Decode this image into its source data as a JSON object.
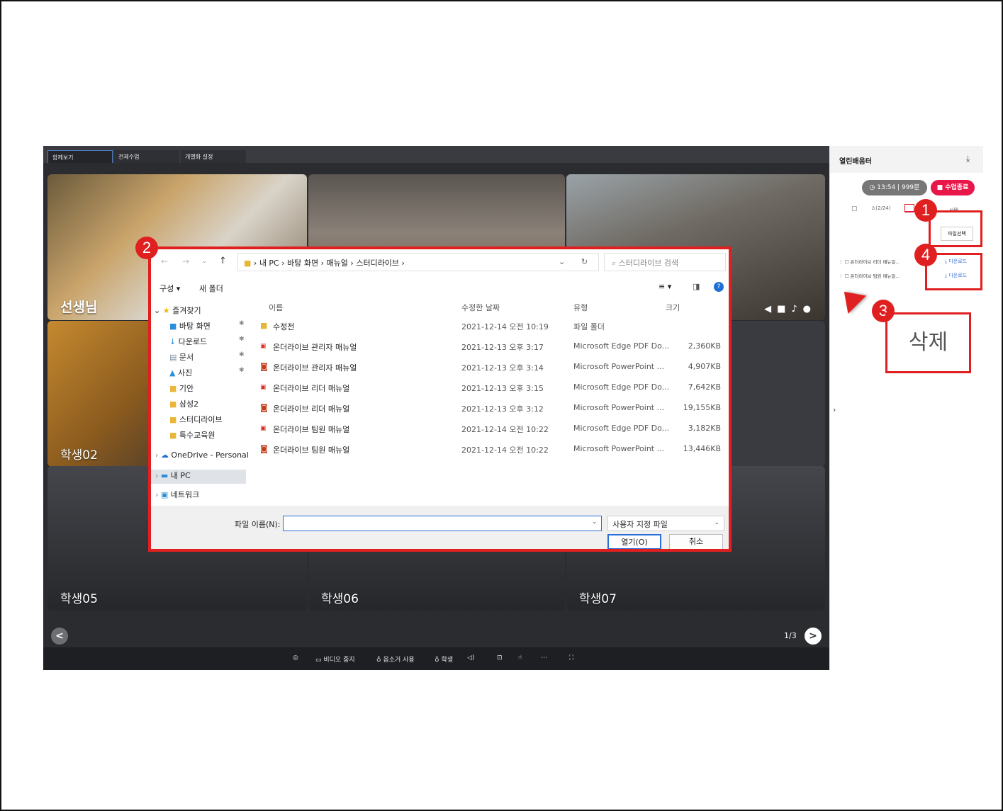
{
  "app": {
    "tabs": [
      "함께보기",
      "전체수업",
      "개별화 설정"
    ],
    "tiles": [
      {
        "label": "선생님"
      },
      {
        "label": "학생02"
      },
      {
        "label": "학생05"
      },
      {
        "label": "학생06"
      },
      {
        "label": "학생07"
      }
    ],
    "pager": {
      "prev": "<",
      "next": ">",
      "indicator": "1/3"
    },
    "bottom_bar": {
      "video_stop": "비디오 중지",
      "mic_use": "음소거 사용",
      "student": "학생"
    },
    "colors": {
      "accent": "#e02020",
      "link": "#3a6fd8",
      "bg": "#2b2c30"
    }
  },
  "side_panel": {
    "title": "열린배움터",
    "timer": "13:54",
    "duration": "999분",
    "end_class": "수업종료",
    "tab_count": "(2/24)",
    "tab_more": "선택",
    "choose_file": "파일선택",
    "files": [
      {
        "name": "온더라이브 리더 매뉴얼...",
        "action": "다운로드"
      },
      {
        "name": "온더라이브 팀원 매뉴얼...",
        "action": "다운로드"
      }
    ],
    "collapse": "›"
  },
  "dialog": {
    "breadcrumb": [
      "내 PC",
      "바탕 화면",
      "매뉴얼",
      "스터디라이브"
    ],
    "search_placeholder": "스터디라이브 검색",
    "organize": "구성 ▾",
    "new_folder": "새 폴더",
    "nav": {
      "favorites": "즐겨찾기",
      "items": [
        "바탕 화면",
        "다운로드",
        "문서",
        "사진",
        "기안",
        "삼성2",
        "스터디라이브",
        "특수교육원"
      ],
      "onedrive": "OneDrive - Personal",
      "my_pc": "내 PC",
      "network": "네트워크"
    },
    "columns": [
      "이름",
      "수정한 날짜",
      "유형",
      "크기"
    ],
    "rows": [
      {
        "name": "수정전",
        "date": "2021-12-14 오전 10:19",
        "type": "파일 폴더",
        "size": "",
        "icon": "folder"
      },
      {
        "name": "온더라이브 관리자 매뉴얼",
        "date": "2021-12-13 오후 3:17",
        "type": "Microsoft Edge PDF Do...",
        "size": "2,360KB",
        "icon": "pdf"
      },
      {
        "name": "온더라이브 관리자 매뉴얼",
        "date": "2021-12-13 오후 3:14",
        "type": "Microsoft PowerPoint ...",
        "size": "4,907KB",
        "icon": "ppt"
      },
      {
        "name": "온더라이브 리더 매뉴얼",
        "date": "2021-12-13 오후 3:15",
        "type": "Microsoft Edge PDF Do...",
        "size": "7,642KB",
        "icon": "pdf"
      },
      {
        "name": "온더라이브 리더 매뉴얼",
        "date": "2021-12-13 오후 3:12",
        "type": "Microsoft PowerPoint ...",
        "size": "19,155KB",
        "icon": "ppt"
      },
      {
        "name": "온더라이브 팀원 매뉴얼",
        "date": "2021-12-14 오전 10:22",
        "type": "Microsoft Edge PDF Do...",
        "size": "3,182KB",
        "icon": "pdf"
      },
      {
        "name": "온더라이브 팀원 매뉴얼",
        "date": "2021-12-14 오전 10:22",
        "type": "Microsoft PowerPoint ...",
        "size": "13,446KB",
        "icon": "ppt"
      }
    ],
    "filename_label": "파일 이름(N):",
    "filename_value": "",
    "filter": "사용자 지정 파일",
    "open": "열기(O)",
    "cancel": "취소"
  },
  "annotations": {
    "badges": [
      "1",
      "2",
      "3",
      "4"
    ],
    "delete_label": "삭제"
  }
}
